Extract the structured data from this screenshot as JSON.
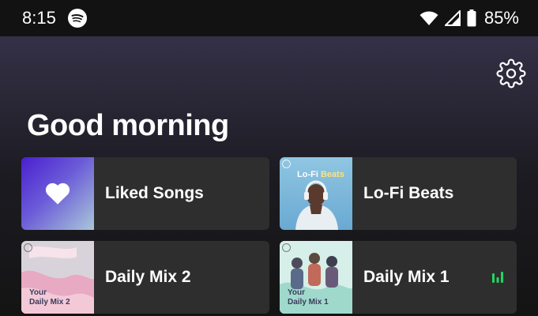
{
  "status_bar": {
    "time": "8:15",
    "battery_percent": "85%",
    "icons": [
      "spotify-icon",
      "wifi-icon",
      "cell-signal-icon",
      "battery-icon"
    ]
  },
  "header": {
    "greeting": "Good morning",
    "settings_icon": "gear-icon"
  },
  "shortcuts": [
    {
      "label": "Liked Songs"
    },
    {
      "label": "Lo-Fi Beats",
      "art_text": [
        "Lo-Fi",
        "Beats"
      ]
    },
    {
      "label": "Daily Mix 2",
      "art_text": [
        "Your",
        "Daily Mix 2"
      ]
    },
    {
      "label": "Daily Mix 1",
      "art_text": [
        "Your",
        "Daily Mix 1"
      ],
      "now_playing": true
    }
  ],
  "colors": {
    "accent_green": "#1ed760",
    "card_bg": "#2e2e2e",
    "liked_gradient_start": "#4a1fd0"
  }
}
